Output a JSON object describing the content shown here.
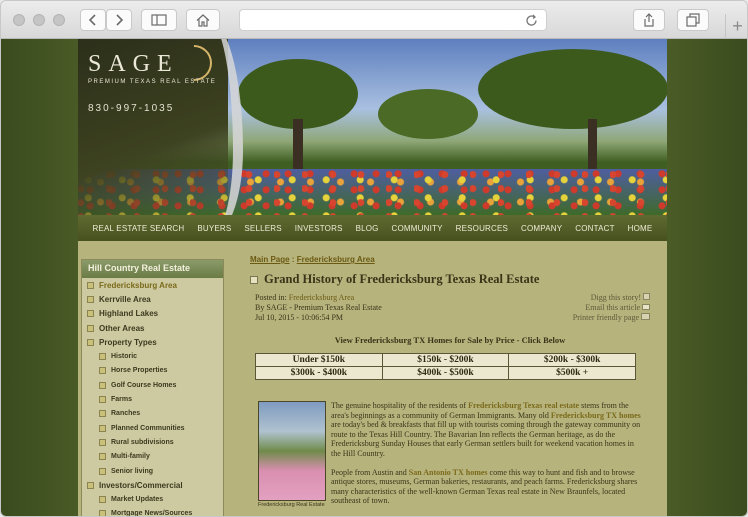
{
  "browser": {
    "window_controls": [
      "close",
      "minimize",
      "maximize"
    ],
    "toolbar_icons": [
      "back-icon",
      "forward-icon",
      "sidebar-icon",
      "home-icon",
      "reload-icon",
      "share-icon",
      "tabs-icon",
      "new-tab-icon"
    ]
  },
  "site": {
    "logo": "SAGE",
    "tagline": "PREMIUM TEXAS REAL ESTATE",
    "phone": "830-997-1035"
  },
  "nav": [
    "REAL ESTATE SEARCH",
    "BUYERS",
    "SELLERS",
    "INVESTORS",
    "BLOG",
    "COMMUNITY",
    "RESOURCES",
    "COMPANY",
    "CONTACT",
    "HOME"
  ],
  "sidebar": {
    "title": "Hill Country Real Estate",
    "items": [
      {
        "label": "Fredericksburg Area",
        "level": 0,
        "active": true
      },
      {
        "label": "Kerrville Area",
        "level": 0
      },
      {
        "label": "Highland Lakes",
        "level": 0
      },
      {
        "label": "Other Areas",
        "level": 0
      },
      {
        "label": "Property Types",
        "level": 0
      },
      {
        "label": "Historic",
        "level": 1
      },
      {
        "label": "Horse Properties",
        "level": 1
      },
      {
        "label": "Golf Course Homes",
        "level": 1
      },
      {
        "label": "Farms",
        "level": 1
      },
      {
        "label": "Ranches",
        "level": 1
      },
      {
        "label": "Planned Communities",
        "level": 1
      },
      {
        "label": "Rural subdivisions",
        "level": 1
      },
      {
        "label": "Multi-family",
        "level": 1
      },
      {
        "label": "Senior living",
        "level": 1
      },
      {
        "label": "Investors/Commercial",
        "level": 0
      },
      {
        "label": "Market Updates",
        "level": 1
      },
      {
        "label": "Mortgage News/Sources",
        "level": 1
      }
    ]
  },
  "breadcrumb": {
    "main": "Main Page",
    "sep": " : ",
    "current": "Fredericksburg Area"
  },
  "article": {
    "title": "Grand History of Fredericksburg Texas Real Estate",
    "posted_label": "Posted in: ",
    "posted_in": "Fredericksburg Area",
    "by": "By SAGE - Premium Texas Real Estate",
    "date": "Jul 10, 2015 - 10:06:54 PM",
    "actions": [
      "Digg this story!",
      "Email this article",
      "Printer friendly page"
    ],
    "price_heading": "View Fredericksburg TX Homes for Sale by Price - Click Below",
    "price_rows": [
      [
        "Under $150k",
        "$150k - $200k",
        "$200k - $300k"
      ],
      [
        "$300k - $400k",
        "$400k - $500k",
        "$500k +"
      ]
    ],
    "photo_caption": "Fredericksburg Real Estate",
    "p1_a": "The genuine hospitality of the residents of ",
    "p1_link1": "Fredericksburg Texas real estate",
    "p1_b": " stems from the area's beginnings as a community of German Immigrants.  Many old ",
    "p1_link2": "Fredericksburg TX homes",
    "p1_c": " are today's bed & breakfasts that fill up with tourists coming through the gateway community on route to the Texas Hill Country.  The Bavarian Inn reflects the German heritage, as do the Fredericksburg Sunday Houses that early German settlers built for weekend vacation homes in the Hill Country.",
    "p2_a": "People from Austin and ",
    "p2_link": "San Antonio TX homes",
    "p2_b": " come this way to hunt and fish and to browse antique stores, museums, German bakeries, restaurants, and peach farms.  Fredericksburg shares many characteristics of the well-known German Texas real estate in New Braunfels, located southeast of town."
  }
}
